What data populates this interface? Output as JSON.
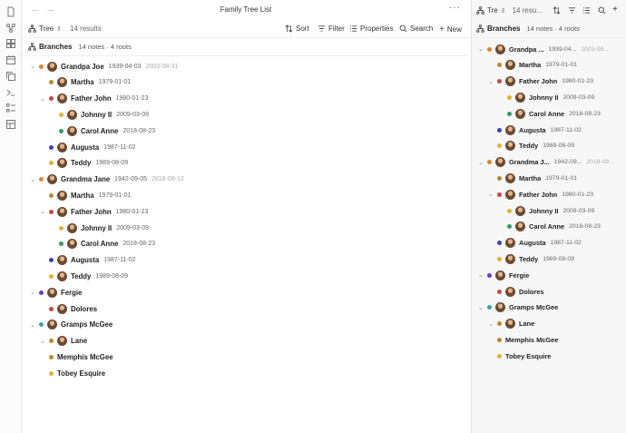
{
  "colors": {
    "orange": "#d9892f",
    "purple": "#6a3fc0",
    "red": "#c9483f",
    "green": "#2e9c6b",
    "yellow": "#e2b233",
    "blue": "#3b3fbf",
    "teal": "#35a6a6",
    "gold": "#b98a2c"
  },
  "window": {
    "title": "Family Tree List",
    "back_icon": "arrow-left-icon",
    "forward_icon": "arrow-right-icon",
    "more": "···"
  },
  "rail": [
    "file-icon",
    "graph-icon",
    "blocks-icon",
    "calendar-icon",
    "copy-icon",
    "terminal-icon",
    "checklist-icon",
    "layout-icon"
  ],
  "main": {
    "view": "Tree",
    "results": "14 results",
    "toolbar": {
      "sort": "Sort",
      "filter": "Filter",
      "properties": "Properties",
      "search": "Search",
      "new": "New"
    },
    "branches_label": "Branches",
    "branches_count": "14 notes · 4 roots"
  },
  "side": {
    "view": "Tre",
    "results": "14 resu...",
    "branches_label": "Branches",
    "branches_count": "14 notes · 4 roots"
  },
  "main_rows": [
    {
      "indent": 0,
      "chev": "v",
      "dot": "orange",
      "avatar": true,
      "name": "Grandpa Joe",
      "date": "1939-04-03",
      "date2": "2003-08-31"
    },
    {
      "indent": 1,
      "chev": "",
      "dot": "gold",
      "avatar": true,
      "name": "Martha",
      "date": "1979-01-01",
      "date2": ""
    },
    {
      "indent": 1,
      "chev": "v",
      "dot": "red",
      "avatar": true,
      "name": "Father John",
      "date": "1980-01-23",
      "date2": ""
    },
    {
      "indent": 2,
      "chev": "",
      "dot": "yellow",
      "avatar": true,
      "name": "Johnny II",
      "date": "2009-03-09",
      "date2": ""
    },
    {
      "indent": 2,
      "chev": "",
      "dot": "green",
      "avatar": true,
      "name": "Carol Anne",
      "date": "2018-08-23",
      "date2": ""
    },
    {
      "indent": 1,
      "chev": "",
      "dot": "blue",
      "avatar": true,
      "name": "Augusta",
      "date": "1987-11-02",
      "date2": ""
    },
    {
      "indent": 1,
      "chev": "",
      "dot": "yellow",
      "avatar": true,
      "name": "Teddy",
      "date": "1989-08-09",
      "date2": ""
    },
    {
      "indent": 0,
      "chev": "v",
      "dot": "orange",
      "avatar": true,
      "name": "Grandma Jane",
      "date": "1942-09-05",
      "date2": "2018-09-12"
    },
    {
      "indent": 1,
      "chev": "",
      "dot": "gold",
      "avatar": true,
      "name": "Martha",
      "date": "1979-01-01",
      "date2": ""
    },
    {
      "indent": 1,
      "chev": "v",
      "dot": "red",
      "avatar": true,
      "name": "Father John",
      "date": "1980-01-23",
      "date2": ""
    },
    {
      "indent": 2,
      "chev": "",
      "dot": "yellow",
      "avatar": true,
      "name": "Johnny II",
      "date": "2009-03-09",
      "date2": ""
    },
    {
      "indent": 2,
      "chev": "",
      "dot": "green",
      "avatar": true,
      "name": "Carol Anne",
      "date": "2018-08-23",
      "date2": ""
    },
    {
      "indent": 1,
      "chev": "",
      "dot": "blue",
      "avatar": true,
      "name": "Augusta",
      "date": "1987-11-02",
      "date2": ""
    },
    {
      "indent": 1,
      "chev": "",
      "dot": "yellow",
      "avatar": true,
      "name": "Teddy",
      "date": "1989-08-09",
      "date2": ""
    },
    {
      "indent": 0,
      "chev": "v",
      "dot": "purple",
      "avatar": true,
      "name": "Fergie",
      "date": "",
      "date2": ""
    },
    {
      "indent": 1,
      "chev": "",
      "dot": "red",
      "avatar": true,
      "name": "Dolores",
      "date": "",
      "date2": ""
    },
    {
      "indent": 0,
      "chev": "v",
      "dot": "teal",
      "avatar": true,
      "name": "Gramps McGee",
      "date": "",
      "date2": ""
    },
    {
      "indent": 1,
      "chev": "v",
      "dot": "gold",
      "avatar": true,
      "name": "Lane",
      "date": "",
      "date2": ""
    },
    {
      "indent": 1,
      "chev": "",
      "dot": "gold",
      "avatar": false,
      "name": "Memphis McGee",
      "date": "",
      "date2": ""
    },
    {
      "indent": 1,
      "chev": "",
      "dot": "yellow",
      "avatar": false,
      "name": "Tobey Esquire",
      "date": "",
      "date2": ""
    }
  ],
  "side_rows": [
    {
      "indent": 0,
      "chev": "v",
      "dot": "orange",
      "avatar": true,
      "name": "Grandpa ...",
      "date": "1939-04...",
      "date2": "2003-08..."
    },
    {
      "indent": 1,
      "chev": "",
      "dot": "gold",
      "avatar": true,
      "name": "Martha",
      "date": "1979-01-01",
      "date2": ""
    },
    {
      "indent": 1,
      "chev": "v",
      "dot": "red",
      "avatar": true,
      "name": "Father John",
      "date": "1980-01-23",
      "date2": ""
    },
    {
      "indent": 2,
      "chev": "",
      "dot": "yellow",
      "avatar": true,
      "name": "Johnny II",
      "date": "2009-03-09",
      "date2": ""
    },
    {
      "indent": 2,
      "chev": "",
      "dot": "green",
      "avatar": true,
      "name": "Carol Anne",
      "date": "2018-08-23",
      "date2": ""
    },
    {
      "indent": 1,
      "chev": "",
      "dot": "blue",
      "avatar": true,
      "name": "Augusta",
      "date": "1987-11-02",
      "date2": ""
    },
    {
      "indent": 1,
      "chev": "",
      "dot": "yellow",
      "avatar": true,
      "name": "Teddy",
      "date": "1989-08-09",
      "date2": ""
    },
    {
      "indent": 0,
      "chev": "v",
      "dot": "orange",
      "avatar": true,
      "name": "Grandma J...",
      "date": "1942-09...",
      "date2": "2018-09..."
    },
    {
      "indent": 1,
      "chev": "",
      "dot": "gold",
      "avatar": true,
      "name": "Martha",
      "date": "1979-01-01",
      "date2": ""
    },
    {
      "indent": 1,
      "chev": "v",
      "dot": "red",
      "avatar": true,
      "name": "Father John",
      "date": "1980-01-23",
      "date2": ""
    },
    {
      "indent": 2,
      "chev": "",
      "dot": "yellow",
      "avatar": true,
      "name": "Johnny II",
      "date": "2009-03-09",
      "date2": ""
    },
    {
      "indent": 2,
      "chev": "",
      "dot": "green",
      "avatar": true,
      "name": "Carol Anne",
      "date": "2018-08-23",
      "date2": ""
    },
    {
      "indent": 1,
      "chev": "",
      "dot": "blue",
      "avatar": true,
      "name": "Augusta",
      "date": "1987-11-02",
      "date2": ""
    },
    {
      "indent": 1,
      "chev": "",
      "dot": "yellow",
      "avatar": true,
      "name": "Teddy",
      "date": "1989-08-09",
      "date2": ""
    },
    {
      "indent": 0,
      "chev": "v",
      "dot": "purple",
      "avatar": true,
      "name": "Fergie",
      "date": "",
      "date2": ""
    },
    {
      "indent": 1,
      "chev": "",
      "dot": "red",
      "avatar": true,
      "name": "Dolores",
      "date": "",
      "date2": ""
    },
    {
      "indent": 0,
      "chev": "v",
      "dot": "teal",
      "avatar": true,
      "name": "Gramps McGee",
      "date": "",
      "date2": ""
    },
    {
      "indent": 1,
      "chev": "v",
      "dot": "gold",
      "avatar": true,
      "name": "Lane",
      "date": "",
      "date2": ""
    },
    {
      "indent": 1,
      "chev": "",
      "dot": "gold",
      "avatar": false,
      "name": "Memphis McGee",
      "date": "",
      "date2": ""
    },
    {
      "indent": 1,
      "chev": "",
      "dot": "yellow",
      "avatar": false,
      "name": "Tobey Esquire",
      "date": "",
      "date2": ""
    }
  ]
}
